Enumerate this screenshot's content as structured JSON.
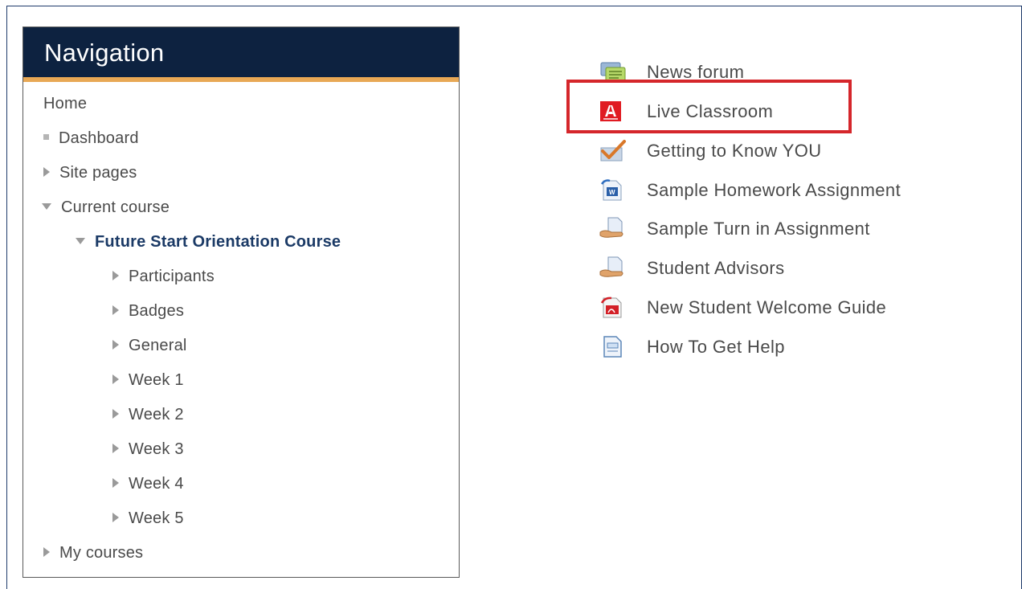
{
  "navigation": {
    "title": "Navigation",
    "items": [
      {
        "label": "Home",
        "marker": "none"
      },
      {
        "label": "Dashboard",
        "marker": "square"
      },
      {
        "label": "Site pages",
        "marker": "collapsed"
      },
      {
        "label": "Current course",
        "marker": "expanded"
      },
      {
        "label": "Future Start Orientation Course",
        "marker": "expanded",
        "bold": true
      },
      {
        "label": "Participants",
        "marker": "collapsed"
      },
      {
        "label": "Badges",
        "marker": "collapsed"
      },
      {
        "label": "General",
        "marker": "collapsed"
      },
      {
        "label": "Week 1",
        "marker": "collapsed"
      },
      {
        "label": "Week 2",
        "marker": "collapsed"
      },
      {
        "label": "Week 3",
        "marker": "collapsed"
      },
      {
        "label": "Week 4",
        "marker": "collapsed"
      },
      {
        "label": "Week 5",
        "marker": "collapsed"
      },
      {
        "label": "My courses",
        "marker": "collapsed"
      }
    ]
  },
  "activities": [
    {
      "label": "News forum",
      "icon": "forum-icon"
    },
    {
      "label": "Live Classroom",
      "icon": "adobe-connect-icon",
      "highlighted": true
    },
    {
      "label": "Getting to Know YOU",
      "icon": "feedback-check-icon"
    },
    {
      "label": "Sample Homework Assignment",
      "icon": "word-document-icon"
    },
    {
      "label": "Sample Turn in Assignment",
      "icon": "assignment-hand-icon"
    },
    {
      "label": "Student Advisors",
      "icon": "assignment-hand-icon"
    },
    {
      "label": "New Student Welcome Guide",
      "icon": "pdf-icon"
    },
    {
      "label": "How To Get Help",
      "icon": "page-icon"
    }
  ],
  "colors": {
    "nav_header_bg": "#0d2240",
    "nav_header_accent": "#e8a855",
    "highlight": "#d5262b",
    "bold_link": "#1b3a66"
  }
}
